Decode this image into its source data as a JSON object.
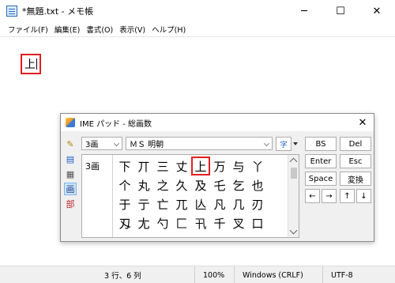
{
  "window": {
    "title": "*無題.txt - メモ帳",
    "controls": {
      "minimize": "─",
      "maximize": "☐",
      "close": "✕"
    }
  },
  "menu": [
    "ファイル(F)",
    "編集(E)",
    "書式(O)",
    "表示(V)",
    "ヘルプ(H)"
  ],
  "editor": {
    "text": "上"
  },
  "status": {
    "position": "3 行、6 列",
    "zoom": "100%",
    "line_ending": "Windows (CRLF)",
    "encoding": "UTF-8"
  },
  "ime": {
    "title": "IME パッド - 総画数",
    "close": "✕",
    "stroke_select": "3画",
    "font_select": "ＭＳ 明朝",
    "tool_label": "字",
    "stroke_label": "3画",
    "side_icons": [
      "handwriting-icon",
      "character-list-icon",
      "soft-keyboard-icon",
      "stroke-count-icon",
      "radical-icon"
    ],
    "side_labels": [
      "✎",
      "▤",
      "▦",
      "画",
      "部"
    ],
    "kanji": [
      "下",
      "丌",
      "三",
      "丈",
      "上",
      "万",
      "与",
      "丫",
      "个",
      "丸",
      "之",
      "久",
      "及",
      "乇",
      "乞",
      "也",
      "于",
      "亍",
      "亡",
      "兀",
      "亾",
      "凡",
      "几",
      "刃",
      "刄",
      "尢",
      "勺",
      "匚",
      "卂",
      "千",
      "叉",
      "口"
    ],
    "highlighted_index": 4,
    "keys": {
      "bs": "BS",
      "del": "Del",
      "enter": "Enter",
      "esc": "Esc",
      "space": "Space",
      "convert": "変換",
      "left": "←",
      "right": "→",
      "up": "↑",
      "down": "↓"
    }
  }
}
